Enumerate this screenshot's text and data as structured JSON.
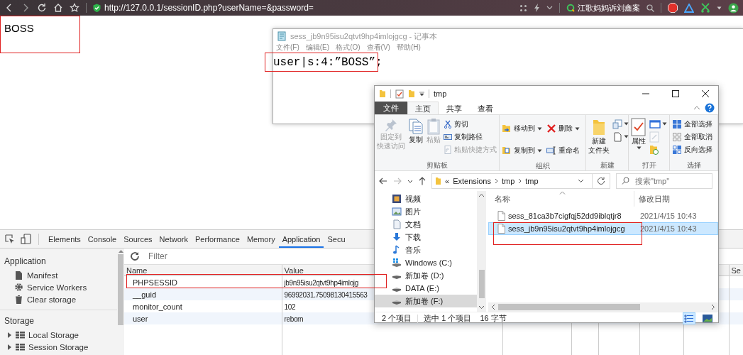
{
  "browser": {
    "url": "http://127.0.0.1/sessionID.php?userName=&password=",
    "search_text": "江歌妈妈诉刘鑫案"
  },
  "page": {
    "text": "BOSS",
    "highlighted": true
  },
  "notepad": {
    "title": "sess_jb9n95isu2qtvt9hp4imlojgcg - 记事本",
    "menu": [
      "文件(F)",
      "编辑(E)",
      "格式(O)",
      "查看(V)",
      "帮助(H)"
    ],
    "content": "user|s:4:”BOSS”;",
    "highlighted": true
  },
  "explorer": {
    "title": "tmp",
    "ribbon_tabs": [
      {
        "label": "文件",
        "kind": "file",
        "selected": false
      },
      {
        "label": "主页",
        "kind": "tab",
        "selected": true
      },
      {
        "label": "共享",
        "kind": "tab",
        "selected": false
      },
      {
        "label": "查看",
        "kind": "tab",
        "selected": false
      }
    ],
    "ribbon_groups": [
      {
        "label": "剪贴板",
        "commands": [
          {
            "kind": "large",
            "lines": [
              "固定到",
              "快速访问"
            ],
            "disabled": true,
            "dropdown": false
          },
          {
            "kind": "large",
            "lines": [
              "复制"
            ],
            "disabled": false,
            "dropdown": false
          },
          {
            "kind": "large",
            "lines": [
              "粘贴"
            ],
            "disabled": true,
            "dropdown": false
          },
          {
            "kind": "small",
            "label": "剪切",
            "disabled": false,
            "dropdown": false
          },
          {
            "kind": "small",
            "label": "复制路径",
            "disabled": false,
            "dropdown": false
          },
          {
            "kind": "small",
            "label": "粘贴快捷方式",
            "disabled": true,
            "dropdown": false
          }
        ]
      },
      {
        "label": "组织",
        "commands": [
          {
            "kind": "small",
            "label": "移动到",
            "disabled": false,
            "dropdown": true
          },
          {
            "kind": "small",
            "label": "复制到",
            "disabled": false,
            "dropdown": true
          },
          {
            "kind": "small",
            "label": "删除",
            "disabled": false,
            "dropdown": true
          },
          {
            "kind": "small",
            "label": "重命名",
            "disabled": false,
            "dropdown": false
          }
        ]
      },
      {
        "label": "新建",
        "commands": [
          {
            "kind": "large",
            "lines": [
              "新建",
              "文件夹"
            ],
            "disabled": false,
            "dropdown": false
          },
          {
            "kind": "icon",
            "disabled": false,
            "dropdown": true
          },
          {
            "kind": "icon",
            "disabled": false,
            "dropdown": true
          }
        ]
      },
      {
        "label": "打开",
        "commands": [
          {
            "kind": "large",
            "lines": [
              "属性"
            ],
            "disabled": false,
            "dropdown": true
          },
          {
            "kind": "icon",
            "disabled": false,
            "dropdown": true
          },
          {
            "kind": "icon",
            "disabled": true,
            "dropdown": false
          },
          {
            "kind": "icon",
            "disabled": false,
            "dropdown": false
          }
        ]
      },
      {
        "label": "选择",
        "commands": [
          {
            "kind": "small",
            "label": "全部选择",
            "disabled": false,
            "dropdown": false
          },
          {
            "kind": "small",
            "label": "全部取消",
            "disabled": false,
            "dropdown": false
          },
          {
            "kind": "small",
            "label": "反向选择",
            "disabled": false,
            "dropdown": false
          }
        ]
      }
    ],
    "breadcrumb": [
      "«",
      "Extensions",
      "tmp",
      "tmp"
    ],
    "search": {
      "placeholder": "搜索\"tmp\""
    },
    "nav_items": [
      {
        "label": "视频",
        "selected": false
      },
      {
        "label": "图片",
        "selected": false
      },
      {
        "label": "文档",
        "selected": false
      },
      {
        "label": "下载",
        "selected": false
      },
      {
        "label": "音乐",
        "selected": false
      },
      {
        "label": "Windows (C:)",
        "selected": false
      },
      {
        "label": "新加卷 (D:)",
        "selected": false
      },
      {
        "label": "DATA (E:)",
        "selected": false
      },
      {
        "label": "新加卷 (F:)",
        "selected": true
      }
    ],
    "columns": [
      "名称",
      "修改日期"
    ],
    "files": [
      {
        "name": "sess_81ca3b7cigfqj52dd9iblqtjr8",
        "modified": "2021/4/15 10:43",
        "selected": false,
        "highlighted": false
      },
      {
        "name": "sess_jb9n95isu2qtvt9hp4imlojgcg",
        "modified": "2021/4/15 10:43",
        "selected": true,
        "highlighted": true
      }
    ],
    "status_bar": {
      "count": "2 个项目",
      "selection": "选中 1 个项目",
      "size": "16 字节"
    },
    "view_buttons": [
      {
        "selected": true
      },
      {
        "selected": false
      }
    ]
  },
  "devtools": {
    "tabs": [
      {
        "label": "Elements",
        "selected": false
      },
      {
        "label": "Console",
        "selected": false
      },
      {
        "label": "Sources",
        "selected": false
      },
      {
        "label": "Network",
        "selected": false
      },
      {
        "label": "Performance",
        "selected": false
      },
      {
        "label": "Memory",
        "selected": false
      },
      {
        "label": "Application",
        "selected": true
      },
      {
        "label": "Secu",
        "selected": false
      }
    ],
    "sidebar": [
      {
        "title": "Application",
        "items": [
          {
            "label": "Manifest"
          },
          {
            "label": "Service Workers"
          },
          {
            "label": "Clear storage"
          }
        ]
      },
      {
        "title": "Storage",
        "items": [
          {
            "label": "Local Storage",
            "expanded": false
          },
          {
            "label": "Session Storage",
            "expanded": false
          }
        ]
      }
    ],
    "filter": {
      "placeholder": "Filter"
    },
    "cookies": {
      "columns": [
        "Name",
        "Value",
        "Se"
      ],
      "rows": [
        {
          "name": "PHPSESSID",
          "value": "jb9n95isu2qtvt9hp4imlojg",
          "highlighted": true
        },
        {
          "name": "__guid",
          "value": "96992031.75098130415563",
          "highlighted": false
        },
        {
          "name": "monitor_count",
          "value": "102",
          "highlighted": false
        },
        {
          "name": "user",
          "value": "reborn",
          "highlighted": false
        }
      ]
    }
  }
}
